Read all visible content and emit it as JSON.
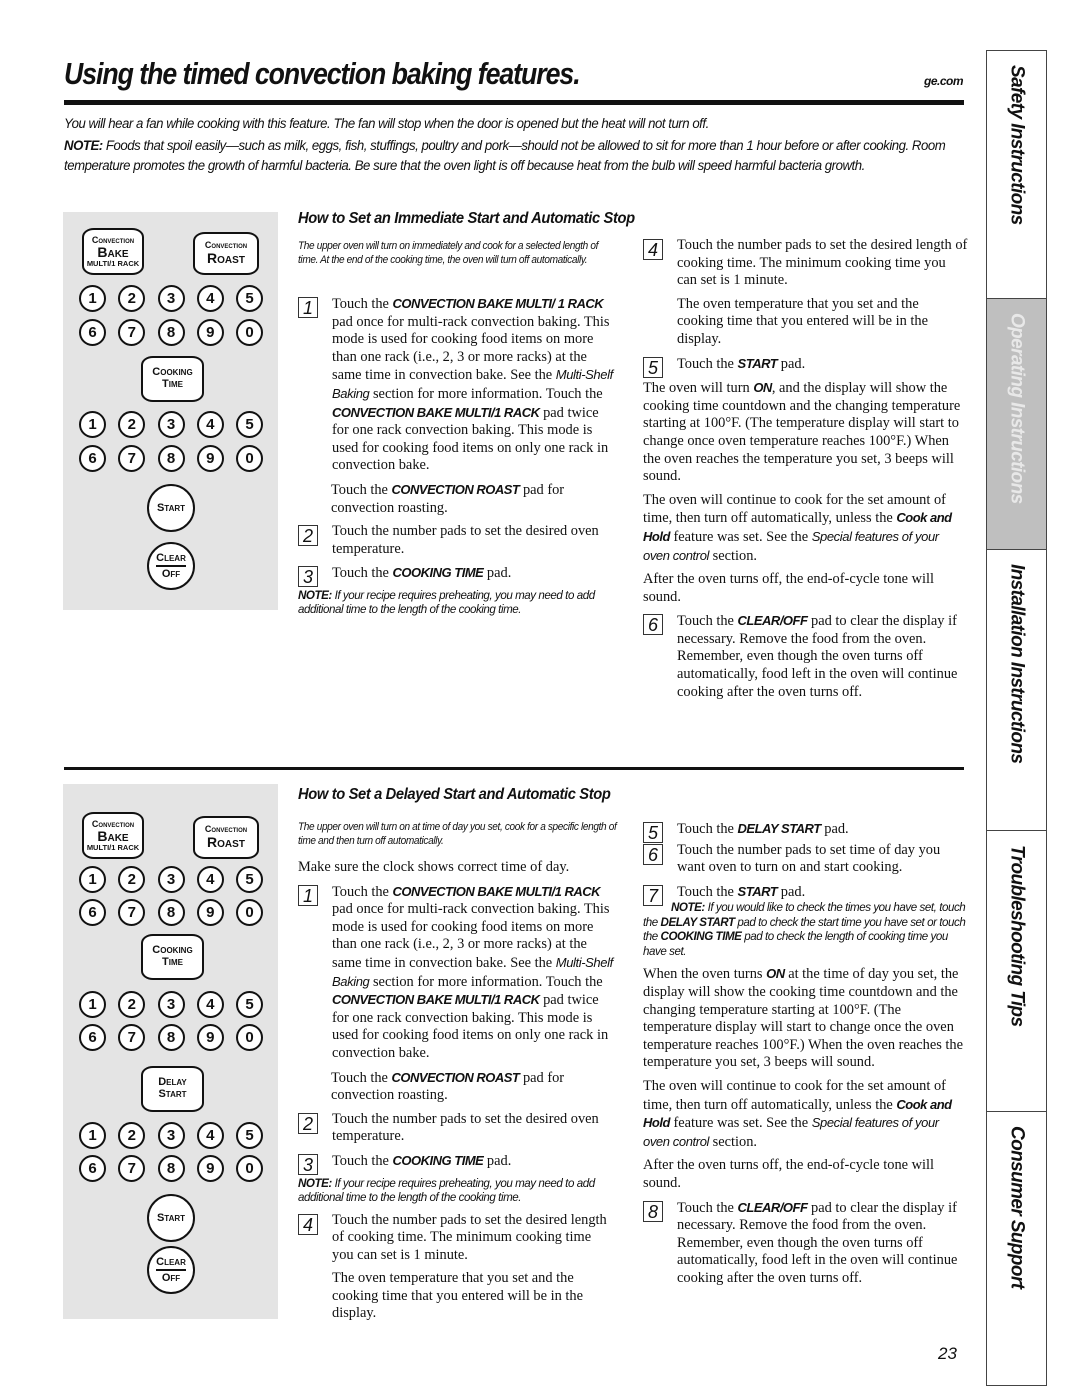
{
  "header": {
    "title": "Using the timed convection baking features.",
    "site": "ge.com"
  },
  "intro": {
    "fan_text": "You will hear a fan while cooking with this feature. The fan will stop when the door is opened but the heat will not turn off.",
    "note_label": "NOTE:",
    "note_text": " Foods that spoil easily—such as milk, eggs, fish, stuffings, poultry and pork—should not be allowed to sit for more than 1 hour before or after cooking. Room temperature promotes the growth of harmful bacteria. Be sure that the oven light is off because heat from the bulb will speed harmful bacteria growth."
  },
  "keypad": {
    "convection_bake": {
      "line1": "Convection",
      "line2": "Bake",
      "line3": "MULTI/1 RACK"
    },
    "convection_roast": {
      "line1": "Convection",
      "line2": "Roast"
    },
    "cooking_time": {
      "line1": "Cooking",
      "line2": "Time"
    },
    "delay_start": {
      "line1": "Delay",
      "line2": "Start"
    },
    "start": "Start",
    "clear": "Clear",
    "off": "Off",
    "row1": [
      "1",
      "2",
      "3",
      "4",
      "5"
    ],
    "row2": [
      "6",
      "7",
      "8",
      "9",
      "0"
    ]
  },
  "immediate": {
    "heading": "How to Set an Immediate Start and Automatic Stop",
    "lead": "The upper oven will turn on immediately and cook for a selected length of time. At the end of the cooking time, the oven will turn off automatically.",
    "step1": {
      "num": "1",
      "t1": "Touch the ",
      "k1": "CONVECTION BAKE MULTI/ 1 RACK",
      "t2": " pad once for multi-rack convection baking. This mode is used for cooking food items on more than one rack (i.e., 2, 3 or more racks) at the same time in convection bake. See the ",
      "i1": "Multi-Shelf Baking",
      "t3": " section for more information. Touch the ",
      "k2": "CONVECTION BAKE MULTI/1 RACK",
      "t4": " pad twice for one rack convection baking. This mode is used for cooking food items on only one rack in convection bake."
    },
    "step1b": {
      "t1": "Touch the ",
      "k1": "CONVECTION ROAST",
      "t2": " pad for convection roasting."
    },
    "step2": {
      "num": "2",
      "text": "Touch the number pads to set the desired oven temperature."
    },
    "step3": {
      "num": "3",
      "t1": "Touch the ",
      "k1": "COOKING TIME",
      "t2": " pad."
    },
    "note": {
      "label": "NOTE:",
      "text": " If your recipe requires preheating, you may need to add additional time to the length of the cooking time."
    },
    "step4": {
      "num": "4",
      "text": "Touch the number pads to set the desired length of cooking time. The minimum cooking time you can set is 1 minute."
    },
    "step4b": "The oven temperature that you set and the cooking time that you entered will be in the display.",
    "step5": {
      "num": "5",
      "t1": "Touch the ",
      "k1": "START",
      "t2": " pad."
    },
    "para1": {
      "t1": "The oven will turn ",
      "k1": "ON",
      "t2": ", and the display will show the cooking time countdown and the changing temperature starting at 100°F. (The temperature display will start to change once oven temperature reaches 100°F.) When the oven reaches the temperature you set, 3 beeps will sound."
    },
    "para2": {
      "t1": "The oven will continue to cook for the set amount of time, then turn off automatically, unless the ",
      "k1": "Cook and Hold",
      "t2": " feature was set. See the ",
      "i1": "Special features of your oven control",
      "t3": " section."
    },
    "para3": "After the oven turns off, the end-of-cycle tone will sound.",
    "step6": {
      "num": "6",
      "t1": "Touch the ",
      "k1": "CLEAR/OFF",
      "t2": " pad to clear the display if necessary. Remove the food from the oven. Remember, even though the oven turns off automatically, food left in the oven will continue cooking after the oven turns off."
    }
  },
  "delayed": {
    "heading": "How to Set a Delayed Start and Automatic Stop",
    "lead": "The upper oven will turn on at time of day you set, cook for a specific length of time and then turn off automatically.",
    "clock": "Make sure the clock shows correct time of day.",
    "step1": {
      "num": "1",
      "t1": "Touch the ",
      "k1": "CONVECTION BAKE MULTI/1 RACK",
      "t2": " pad once for multi-rack convection baking. This mode is used for cooking food items on more than one rack (i.e., 2, 3 or more racks) at the same time in convection bake. See the ",
      "i1": "Multi-Shelf Baking",
      "t3": " section for more information. Touch the ",
      "k2": "CONVECTION BAKE MULTI/1 RACK",
      "t4": " pad twice for one rack convection baking. This mode is used for cooking food items on only one rack in convection bake."
    },
    "step1b": {
      "t1": "Touch the ",
      "k1": "CONVECTION ROAST",
      "t2": " pad for convection roasting."
    },
    "step2": {
      "num": "2",
      "text": "Touch the number pads to set the desired oven temperature."
    },
    "step3": {
      "num": "3",
      "t1": "Touch the ",
      "k1": "COOKING TIME",
      "t2": " pad."
    },
    "note": {
      "label": "NOTE:",
      "text": " If your recipe requires preheating, you may need to add additional time to the length of the cooking time."
    },
    "step4": {
      "num": "4",
      "text": "Touch the number pads to set the desired length of cooking time. The minimum cooking time you can set is 1 minute."
    },
    "step4b": "The oven temperature that you set and the cooking time that you entered will be in the display.",
    "step5": {
      "num": "5",
      "t1": "Touch the ",
      "k1": "DELAY START",
      "t2": " pad."
    },
    "step6": {
      "num": "6",
      "text": "Touch the number pads to set time of day you want oven to turn on and start cooking."
    },
    "step7": {
      "num": "7",
      "t1": "Touch the ",
      "k1": "START",
      "t2": " pad."
    },
    "note2": {
      "label": "NOTE:",
      "t1": " If you would like to check the times you have set, touch the ",
      "k1": "DELAY START",
      "t2": " pad to check the start time you have set or touch the ",
      "k2": "COOKING TIME",
      "t3": " pad to check the length of cooking time you have set."
    },
    "para1": {
      "t1": "When the oven turns ",
      "k1": "ON",
      "t2": " at the time of day you set, the display will show the cooking time countdown and the changing temperature starting at 100°F. (The temperature display will start to change once the oven temperature reaches 100°F.) When the oven reaches the temperature you set, 3 beeps will sound."
    },
    "para2": {
      "t1": "The oven will continue to cook for the set amount of time, then turn off automatically, unless the ",
      "k1": "Cook and Hold",
      "t2": " feature was set. See the ",
      "i1": "Special features of your oven control",
      "t3": " section."
    },
    "para3": "After the oven turns off, the end-of-cycle tone will sound.",
    "step8": {
      "num": "8",
      "t1": "Touch the ",
      "k1": "CLEAR/OFF",
      "t2": " pad to clear the display if necessary. Remove the food from the oven. Remember, even though the oven turns off automatically, food left in the oven will continue cooking after the oven turns off."
    }
  },
  "page_number": "23",
  "tabs": [
    {
      "label": "Safety Instructions",
      "active": false
    },
    {
      "label": "Operating Instructions",
      "active": true
    },
    {
      "label": "Installation Instructions",
      "active": false
    },
    {
      "label": "Troubleshooting Tips",
      "active": false
    },
    {
      "label": "Consumer Support",
      "active": false
    }
  ],
  "colors": {
    "panel": "#e4e4e4",
    "active_tab": "#bfbfbf",
    "text": "#111111"
  }
}
